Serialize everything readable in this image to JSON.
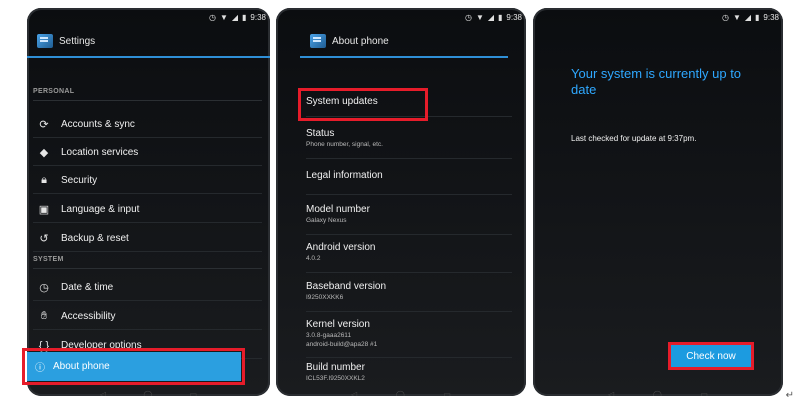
{
  "status": {
    "time": "9:38"
  },
  "panel1": {
    "title": "Settings",
    "sections": [
      {
        "header": "PERSONAL",
        "items": [
          {
            "label": "Accounts & sync",
            "icon": "sync-icon"
          },
          {
            "label": "Location services",
            "icon": "location-icon"
          },
          {
            "label": "Security",
            "icon": "lock-icon"
          },
          {
            "label": "Language & input",
            "icon": "keyboard-icon"
          },
          {
            "label": "Backup & reset",
            "icon": "backup-icon"
          }
        ]
      },
      {
        "header": "SYSTEM",
        "items": [
          {
            "label": "Date & time",
            "icon": "clock-icon"
          },
          {
            "label": "Accessibility",
            "icon": "hand-icon"
          },
          {
            "label": "Developer options",
            "icon": "braces-icon"
          },
          {
            "label": "About phone",
            "icon": "info-icon"
          }
        ]
      }
    ]
  },
  "panel2": {
    "title": "About phone",
    "items": [
      {
        "title": "System updates",
        "sub": ""
      },
      {
        "title": "Status",
        "sub": "Phone number, signal, etc."
      },
      {
        "title": "Legal information",
        "sub": ""
      },
      {
        "title": "Model number",
        "sub": "Galaxy Nexus"
      },
      {
        "title": "Android version",
        "sub": "4.0.2"
      },
      {
        "title": "Baseband version",
        "sub": "I9250XXKK6"
      },
      {
        "title": "Kernel version",
        "sub": "3.0.8-gaaa2611",
        "sub2": "android-build@apa28 #1"
      },
      {
        "title": "Build number",
        "sub": "ICL53F.I9250XXKL2"
      }
    ]
  },
  "panel3": {
    "headline": "Your system is currently up to date",
    "last_checked": "Last checked for update at 9:37pm.",
    "button": "Check now"
  },
  "colors": {
    "accent": "#2b9fe0",
    "highlight": "#e61c2a"
  }
}
